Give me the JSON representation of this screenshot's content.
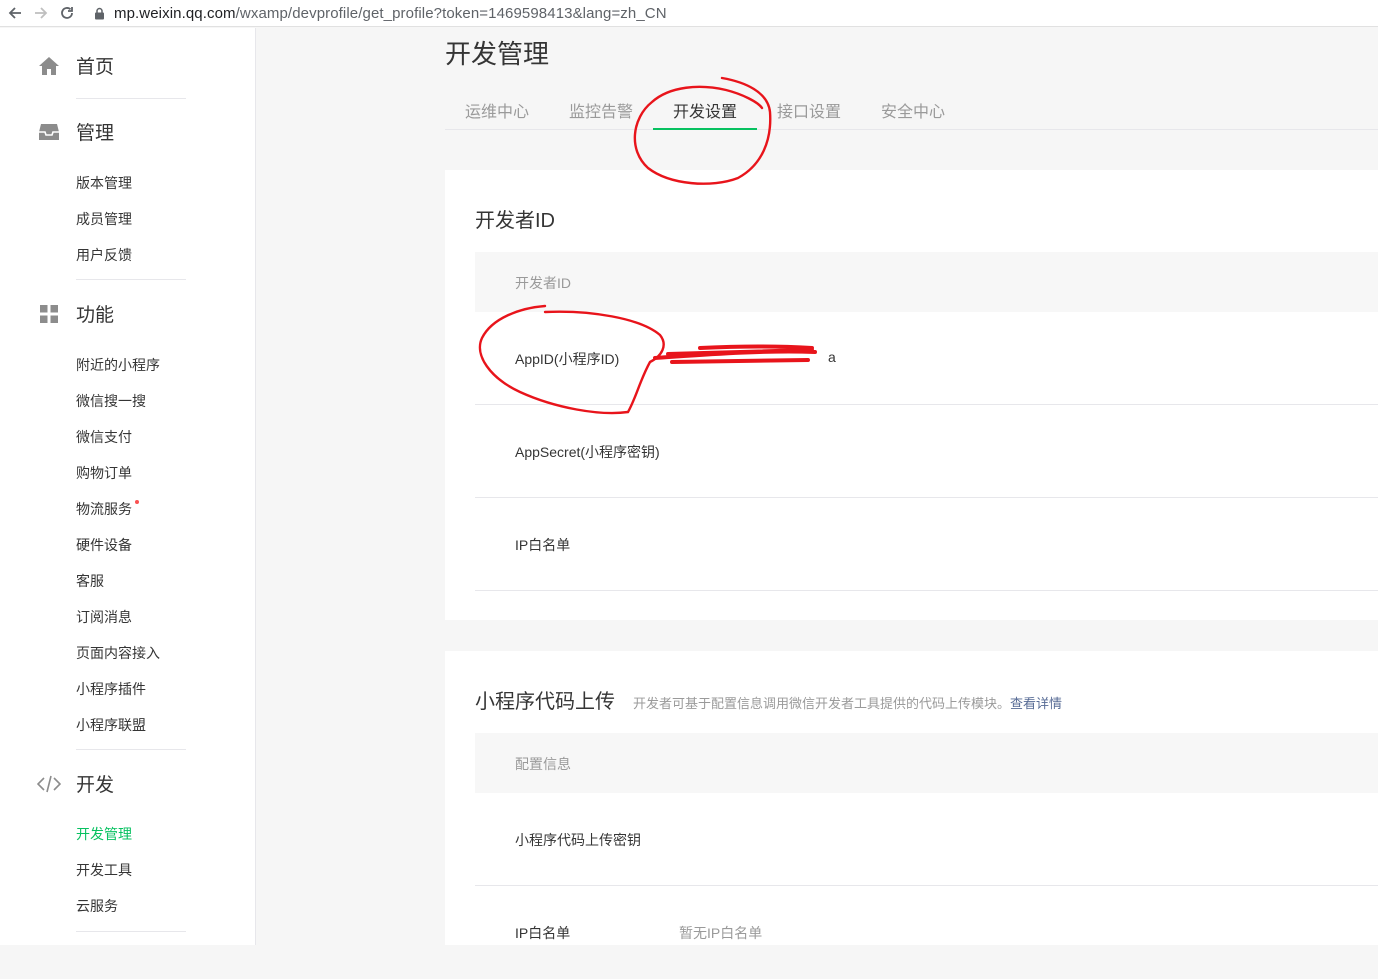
{
  "browser": {
    "url_host": "mp.weixin.qq.com",
    "url_path": "/wxamp/devprofile/get_profile?token=1469598413&lang=zh_CN"
  },
  "sidebar": {
    "sections": [
      {
        "label": "首页",
        "icon": "home-icon"
      },
      {
        "label": "管理",
        "icon": "inbox-icon",
        "items": [
          "版本管理",
          "成员管理",
          "用户反馈"
        ]
      },
      {
        "label": "功能",
        "icon": "grid-icon",
        "items": [
          "附近的小程序",
          "微信搜一搜",
          "微信支付",
          "购物订单",
          "物流服务",
          "硬件设备",
          "客服",
          "订阅消息",
          "页面内容接入",
          "小程序插件",
          "小程序联盟"
        ]
      },
      {
        "label": "开发",
        "icon": "code-icon",
        "items": [
          "开发管理",
          "开发工具",
          "云服务"
        ]
      }
    ]
  },
  "page": {
    "title": "开发管理"
  },
  "tabs": [
    "运维中心",
    "监控告警",
    "开发设置",
    "接口设置",
    "安全中心"
  ],
  "active_tab": "开发设置",
  "developer_id": {
    "title": "开发者ID",
    "header": "开发者ID",
    "rows": [
      {
        "label": "AppID(小程序ID)",
        "value": "a"
      },
      {
        "label": "AppSecret(小程序密钥)",
        "value": ""
      },
      {
        "label": "IP白名单",
        "value": ""
      }
    ]
  },
  "upload": {
    "title": "小程序代码上传",
    "subtitle": "开发者可基于配置信息调用微信开发者工具提供的代码上传模块。",
    "link": "查看详情",
    "header": "配置信息",
    "rows": [
      {
        "label": "小程序代码上传密钥",
        "value": ""
      },
      {
        "label": "IP白名单",
        "value": "暂无IP白名单"
      }
    ]
  },
  "colors": {
    "accent": "#07c160",
    "link": "#576b95",
    "annotation": "#e8141b",
    "alert_dot": "#fa5151"
  }
}
